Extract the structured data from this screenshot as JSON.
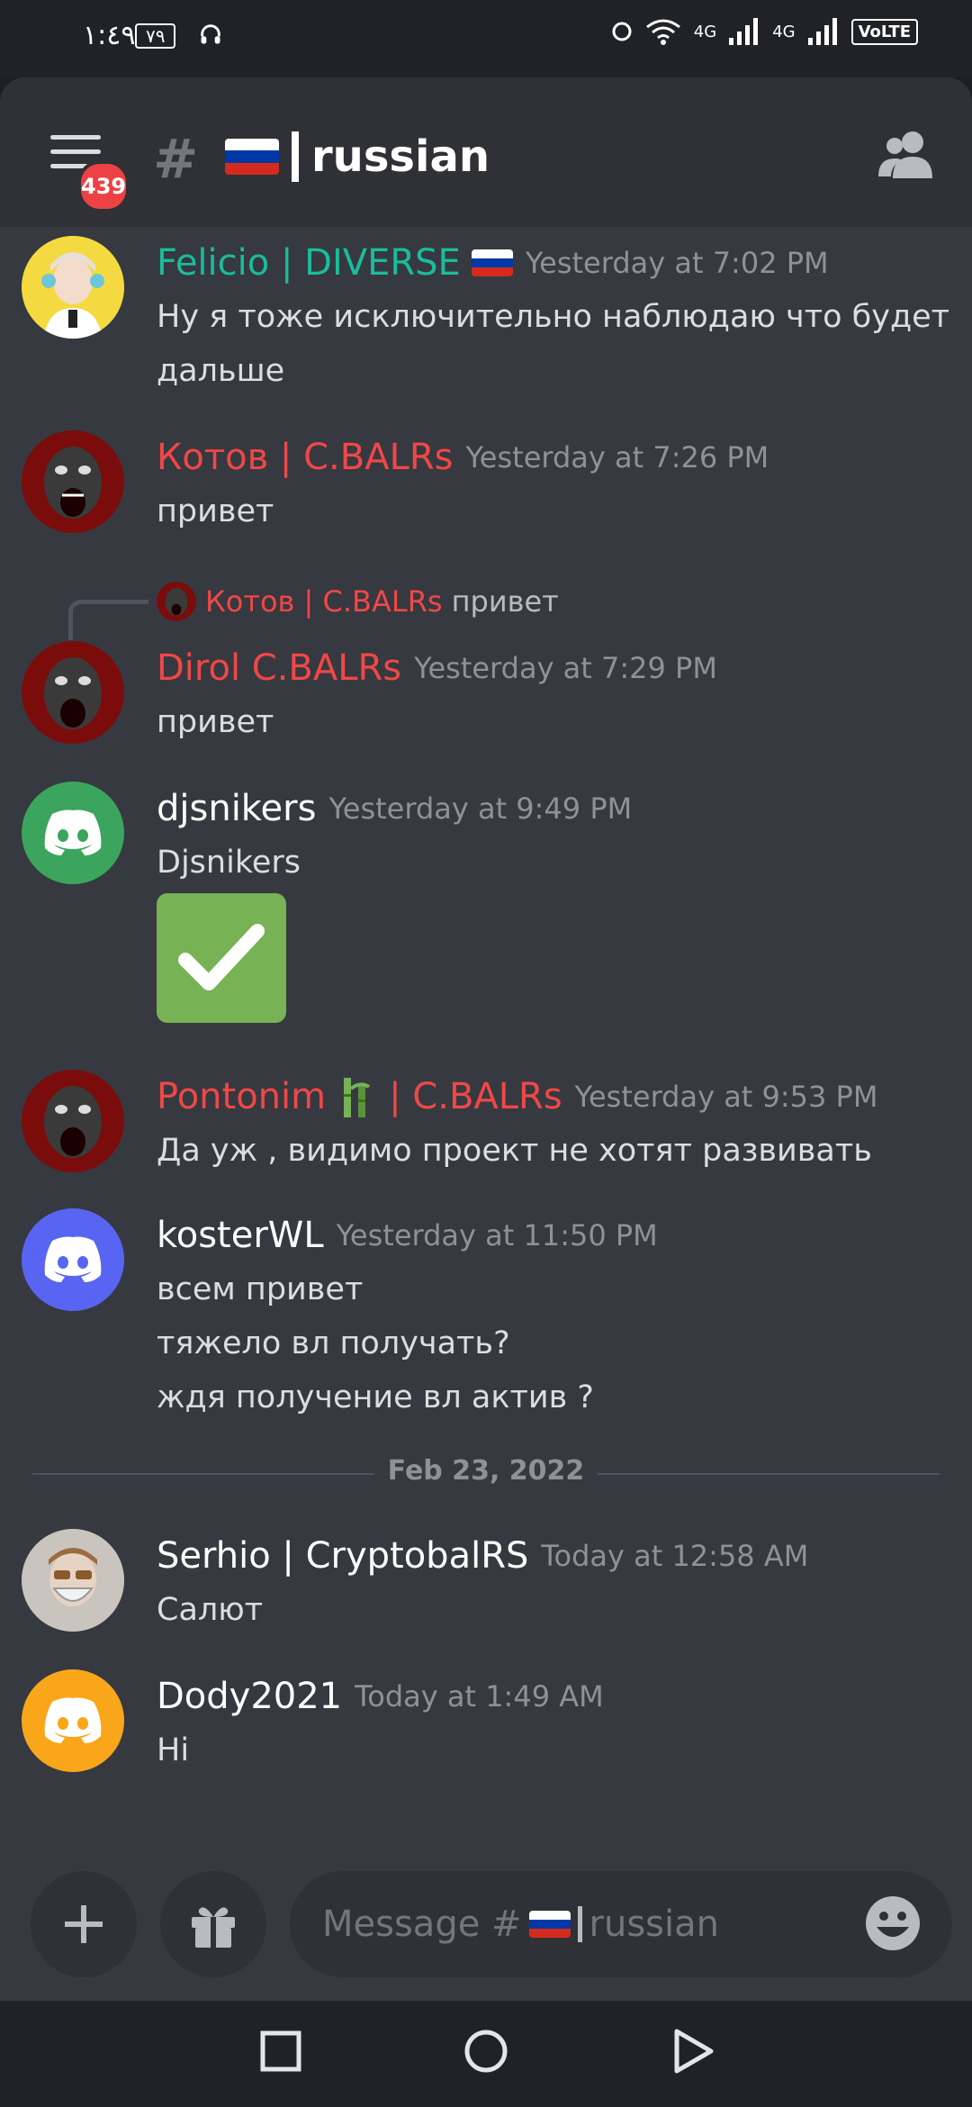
{
  "status_bar": {
    "time": "١:٤٩",
    "battery": "٧٩",
    "net1": "4G",
    "net2": "4G",
    "volte": "VoLTE"
  },
  "header": {
    "badge_count": "439",
    "channel_prefix": "#",
    "channel_name": "russian"
  },
  "messages": [
    {
      "username": "Felicio | DIVERSE",
      "timestamp": "Yesterday at 7:02 PM",
      "lines": [
        "Ну я тоже исключительно наблюдаю что будет",
        "дальше"
      ],
      "name_color": "#1abc9c"
    },
    {
      "username": "Котов | C.BALRs",
      "timestamp": "Yesterday at 7:26 PM",
      "lines": [
        "привет"
      ],
      "name_color": "#f04747"
    },
    {
      "reply_to_user": "Котов | C.BALRs",
      "reply_to_text": "привет",
      "username": "Dirol C.BALRs",
      "timestamp": "Yesterday at 7:29 PM",
      "lines": [
        "привет"
      ],
      "name_color": "#f04747"
    },
    {
      "username": "djsnikers",
      "timestamp": "Yesterday at 9:49 PM",
      "lines": [
        "Djsnikers"
      ],
      "emoji": "check-mark",
      "name_color": "#ffffff"
    },
    {
      "username_part1": "Pontonim",
      "username_part2": "| C.BALRs",
      "timestamp": "Yesterday at 9:53 PM",
      "lines": [
        "Да уж , видимо проект не хотят развивать"
      ],
      "name_color": "#f04747"
    },
    {
      "username": "kosterWL",
      "timestamp": "Yesterday at 11:50 PM",
      "lines": [
        "всем привет",
        "тяжело вл получать?",
        "ждя получение вл актив ?"
      ],
      "name_color": "#ffffff"
    },
    {
      "username": "Serhio | CryptobalRS",
      "timestamp": "Today at 12:58 AM",
      "lines": [
        "Салют"
      ],
      "name_color": "#ffffff"
    },
    {
      "username": "Dody2021",
      "timestamp": "Today at 1:49 AM",
      "lines": [
        "Hi"
      ],
      "name_color": "#ffffff"
    }
  ],
  "date_divider": "Feb 23, 2022",
  "composer": {
    "placeholder_prefix": "Message #",
    "placeholder_channel": "russian"
  },
  "colors": {
    "accent_red": "#f04747",
    "accent_teal": "#1abc9c",
    "discord_green": "#3ba55d",
    "discord_blurple": "#5865f2",
    "discord_orange": "#faa61a"
  }
}
